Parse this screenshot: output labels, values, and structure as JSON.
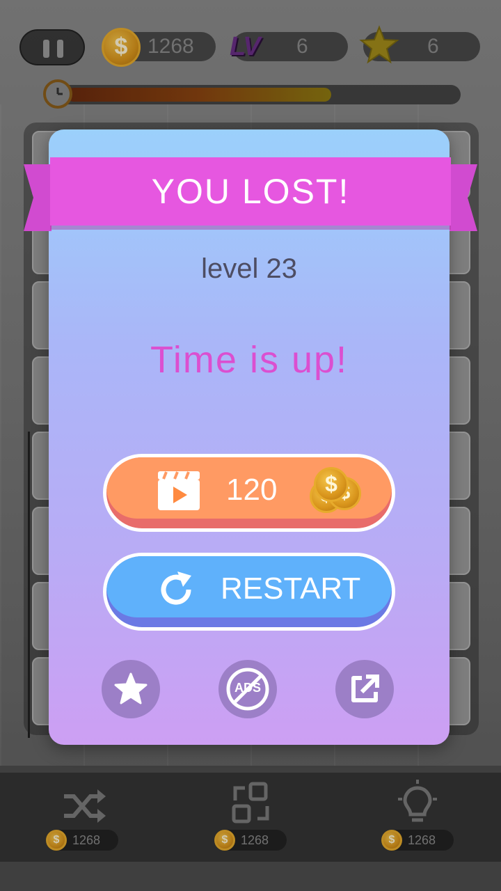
{
  "hud": {
    "coins": "1268",
    "level_badge": "LV",
    "level": "6",
    "stars": "6",
    "timer_remaining_fraction": 0.79
  },
  "dialog": {
    "title": "YOU LOST!",
    "level_text": "level 23",
    "reason": "Time is up!",
    "video_button": {
      "value": "120",
      "icon": "video-play-icon",
      "reward_icon": "coins-icon"
    },
    "restart_button": {
      "label": "RESTART",
      "icon": "restart-icon"
    },
    "bottom_actions": [
      {
        "name": "rate-star-button",
        "icon": "star-icon"
      },
      {
        "name": "remove-ads-button",
        "icon": "no-ads-icon",
        "icon_text": "ADS"
      },
      {
        "name": "share-button",
        "icon": "share-icon"
      }
    ]
  },
  "toolbar": {
    "shuffle": {
      "icon": "shuffle-icon",
      "cost": "1268"
    },
    "swap": {
      "icon": "swap-icon",
      "cost": "1268"
    },
    "hint": {
      "icon": "lightbulb-icon",
      "cost": "1268"
    }
  },
  "colors": {
    "ribbon": "#e657e0",
    "reason_text": "#db4fd0",
    "video_button": "#ff9a63",
    "restart_button": "#5fb1fb",
    "dialog_top": "#9bd0fb",
    "dialog_bottom": "#cd9ff3"
  }
}
